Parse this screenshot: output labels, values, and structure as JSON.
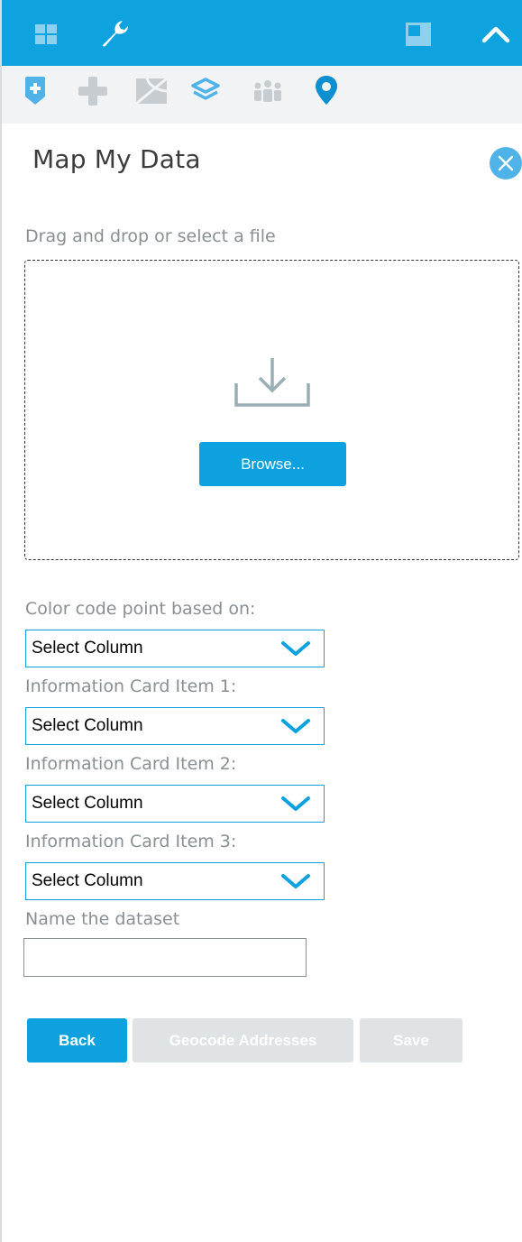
{
  "header": {
    "icons": [
      "grid-icon",
      "wrench-icon",
      "window-icon",
      "chevron-up-icon"
    ]
  },
  "toolbar": {
    "icons": [
      "shield-plus-icon",
      "plus-icon",
      "map-icon",
      "layers-icon",
      "people-icon",
      "location-pin-icon"
    ]
  },
  "panel": {
    "title": "Map My Data",
    "close_icon": "close-icon"
  },
  "upload": {
    "label": "Drag and drop or select a file",
    "browse_label": "Browse...",
    "icon": "download-icon"
  },
  "fields": [
    {
      "label": "Color code point based on:",
      "value": "Select Column"
    },
    {
      "label": "Information Card Item 1:",
      "value": "Select Column"
    },
    {
      "label": "Information Card Item 2:",
      "value": "Select Column"
    },
    {
      "label": "Information Card Item 3:",
      "value": "Select Column"
    }
  ],
  "dataset": {
    "label": "Name the dataset",
    "value": ""
  },
  "actions": {
    "back": "Back",
    "geocode": "Geocode Addresses",
    "save": "Save"
  },
  "colors": {
    "accent": "#0da2df",
    "disabled": "#dfe3e6",
    "label": "#8a8f93"
  }
}
